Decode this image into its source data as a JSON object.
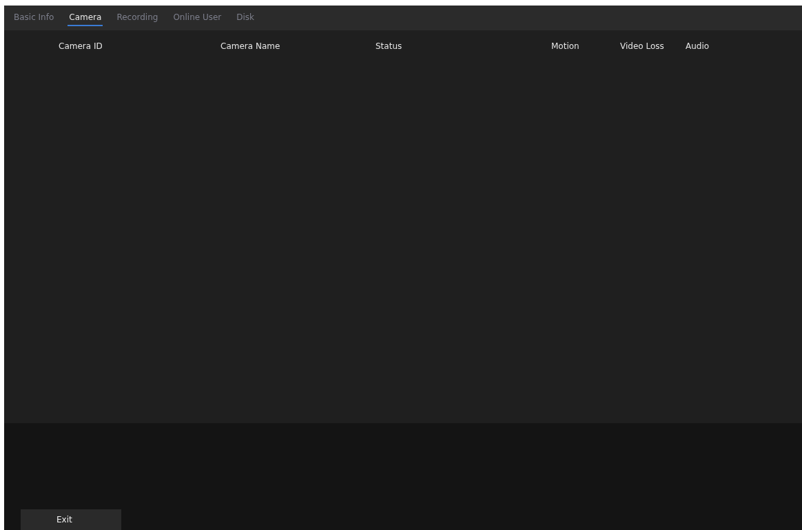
{
  "tabs": [
    {
      "label": "Basic Info",
      "selected": false
    },
    {
      "label": "Camera",
      "selected": true
    },
    {
      "label": "Recording",
      "selected": false
    },
    {
      "label": "Online User",
      "selected": false
    },
    {
      "label": "Disk",
      "selected": false
    }
  ],
  "table": {
    "columns": [
      "Camera ID",
      "Camera Name",
      "Status",
      "Motion",
      "Video Loss",
      "Audio"
    ]
  },
  "buttons": [
    "Exit"
  ]
}
